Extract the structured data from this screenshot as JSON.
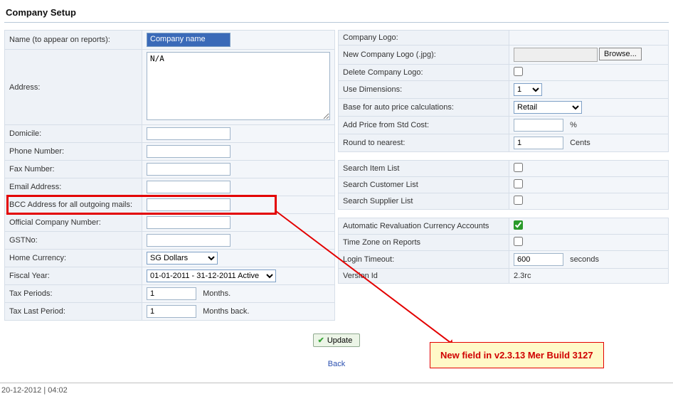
{
  "title": "Company Setup",
  "left": {
    "name_label": "Name (to appear on reports):",
    "name_value": "Company name",
    "address_label": "Address:",
    "address_value": "N/A",
    "domicile_label": "Domicile:",
    "domicile_value": "",
    "phone_label": "Phone Number:",
    "phone_value": "",
    "fax_label": "Fax Number:",
    "fax_value": "",
    "email_label": "Email Address:",
    "email_value": "",
    "bcc_label": "BCC Address for all outgoing mails:",
    "bcc_value": "",
    "coynum_label": "Official Company Number:",
    "coynum_value": "",
    "gst_label": "GSTNo:",
    "gst_value": "",
    "curr_label": "Home Currency:",
    "curr_value": "SG Dollars",
    "fiscal_label": "Fiscal Year:",
    "fiscal_value": "01-01-2011 - 31-12-2011 Active",
    "taxp_label": "Tax Periods:",
    "taxp_value": "1",
    "taxp_unit": "Months.",
    "taxlp_label": "Tax Last Period:",
    "taxlp_value": "1",
    "taxlp_unit": "Months back."
  },
  "right": {
    "logo_label": "Company Logo:",
    "newlogo_label": "New Company Logo (.jpg):",
    "browse_label": "Browse...",
    "dellogo_label": "Delete Company Logo:",
    "dims_label": "Use Dimensions:",
    "dims_value": "1",
    "base_label": "Base for auto price calculations:",
    "base_value": "Retail",
    "addprice_label": "Add Price from Std Cost:",
    "addprice_value": "",
    "addprice_unit": "%",
    "round_label": "Round to nearest:",
    "round_value": "1",
    "round_unit": "Cents",
    "sitem_label": "Search Item List",
    "scust_label": "Search Customer List",
    "ssupp_label": "Search Supplier List",
    "autorev_label": "Automatic Revaluation Currency Accounts",
    "tz_label": "Time Zone on Reports",
    "timeout_label": "Login Timeout:",
    "timeout_value": "600",
    "timeout_unit": "seconds",
    "ver_label": "Version Id",
    "ver_value": "2.3rc"
  },
  "actions": {
    "update": "Update",
    "back": "Back"
  },
  "statusbar": "20-12-2012 | 04:02",
  "annotation": {
    "text": "New field in v2.3.13 Mer Build 3127"
  }
}
